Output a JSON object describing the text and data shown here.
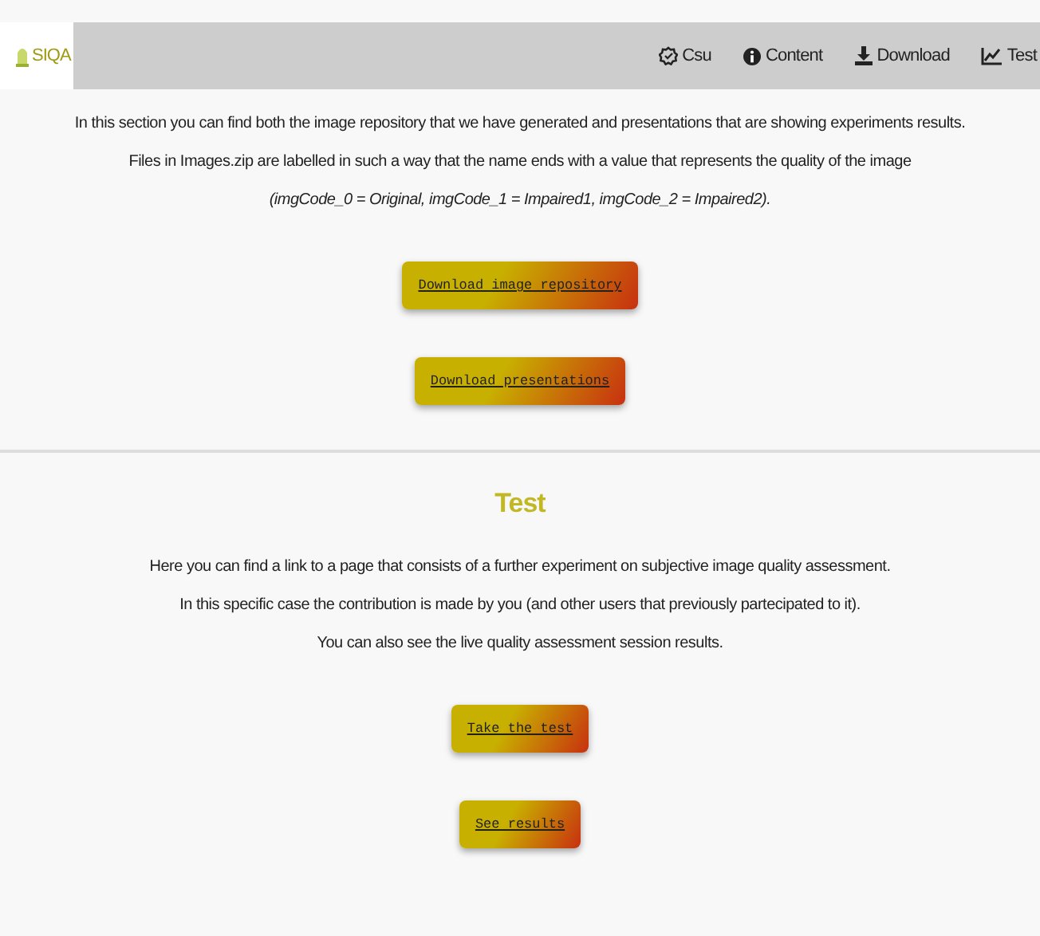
{
  "navbar": {
    "brand": "SIQA",
    "links": [
      {
        "kind": "csu",
        "label": "Csu"
      },
      {
        "kind": "info",
        "label": "Content"
      },
      {
        "kind": "download",
        "label": "Download"
      },
      {
        "kind": "chart",
        "label": "Test"
      }
    ]
  },
  "sections": [
    {
      "lines": [
        {
          "kind": "plain",
          "text": "In this section you can find both the image repository that we have generated and presentations that are showing experiments results."
        },
        {
          "kind": "plain",
          "text": "Files in Images.zip are labelled in such a way that the name ends with a value that represents the quality of the image"
        },
        {
          "kind": "italic",
          "text": "(imgCode_0 = Original, imgCode_1 = Impaired1, imgCode_2 = Impaired2)."
        }
      ],
      "buttons": [
        "Download image repository",
        "Download presentations"
      ]
    },
    {
      "heading": "Test",
      "lines": [
        {
          "kind": "plain",
          "text": "Here you can find a link to a page that consists of a further experiment on subjective image quality assessment."
        },
        {
          "kind": "plain",
          "text": "In this specific case the contribution is made by you (and other users that previously partecipated to it)."
        },
        {
          "kind": "plain",
          "text": "You can also see the live quality assessment session results."
        }
      ],
      "buttons": [
        "Take the test",
        "See results"
      ]
    }
  ]
}
